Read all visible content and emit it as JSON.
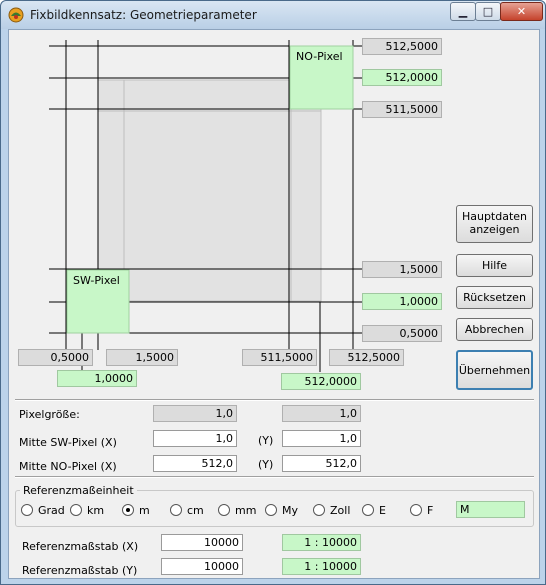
{
  "window": {
    "title": "Fixbildkennsatz: Geometrieparameter"
  },
  "titlebar_buttons": {
    "minimize": "▁",
    "maximize": "□",
    "close": "✕"
  },
  "diagram": {
    "ne_pixel_label": "NO-Pixel",
    "sw_pixel_label": "SW-Pixel",
    "y_top": "512,5000",
    "y_ne": "512,0000",
    "y_below_ne": "511,5000",
    "y_above_sw": "1,5000",
    "y_sw": "1,0000",
    "y_bottom": "0,5000",
    "x_left": "0,5000",
    "x_sw_right": "1,5000",
    "x_ne_left": "511,5000",
    "x_right": "512,5000",
    "x_sw": "1,0000",
    "x_ne": "512,0000"
  },
  "buttons": {
    "hauptdaten_line1": "Hauptdaten",
    "hauptdaten_line2": "anzeigen",
    "hilfe": "Hilfe",
    "ruecksetzen": "Rücksetzen",
    "abbrechen": "Abbrechen",
    "uebernehmen": "Übernehmen"
  },
  "params": {
    "pixelgroesse_label": "Pixelgröße:",
    "pixelgroesse_x": "1,0",
    "pixelgroesse_y": "1,0",
    "sw_label": "Mitte SW-Pixel (X)",
    "sw_x": "1,0",
    "sw_y": "1,0",
    "ne_label": "Mitte NO-Pixel (X)",
    "ne_x": "512,0",
    "ne_y": "512,0",
    "y_label": "(Y)"
  },
  "referenz": {
    "group_title": "Referenzmaßeinheit",
    "units": [
      "Grad",
      "km",
      "m",
      "cm",
      "mm",
      "My",
      "Zoll",
      "E",
      "F"
    ],
    "selected_index": 2,
    "unit_display": "M",
    "mass_x_label": "Referenzmaßstab (X)",
    "mass_x_value": "10000",
    "mass_x_ratio": "1 : 10000",
    "mass_y_label": "Referenzmaßstab (Y)",
    "mass_y_value": "10000",
    "mass_y_ratio": "1 : 10000"
  }
}
